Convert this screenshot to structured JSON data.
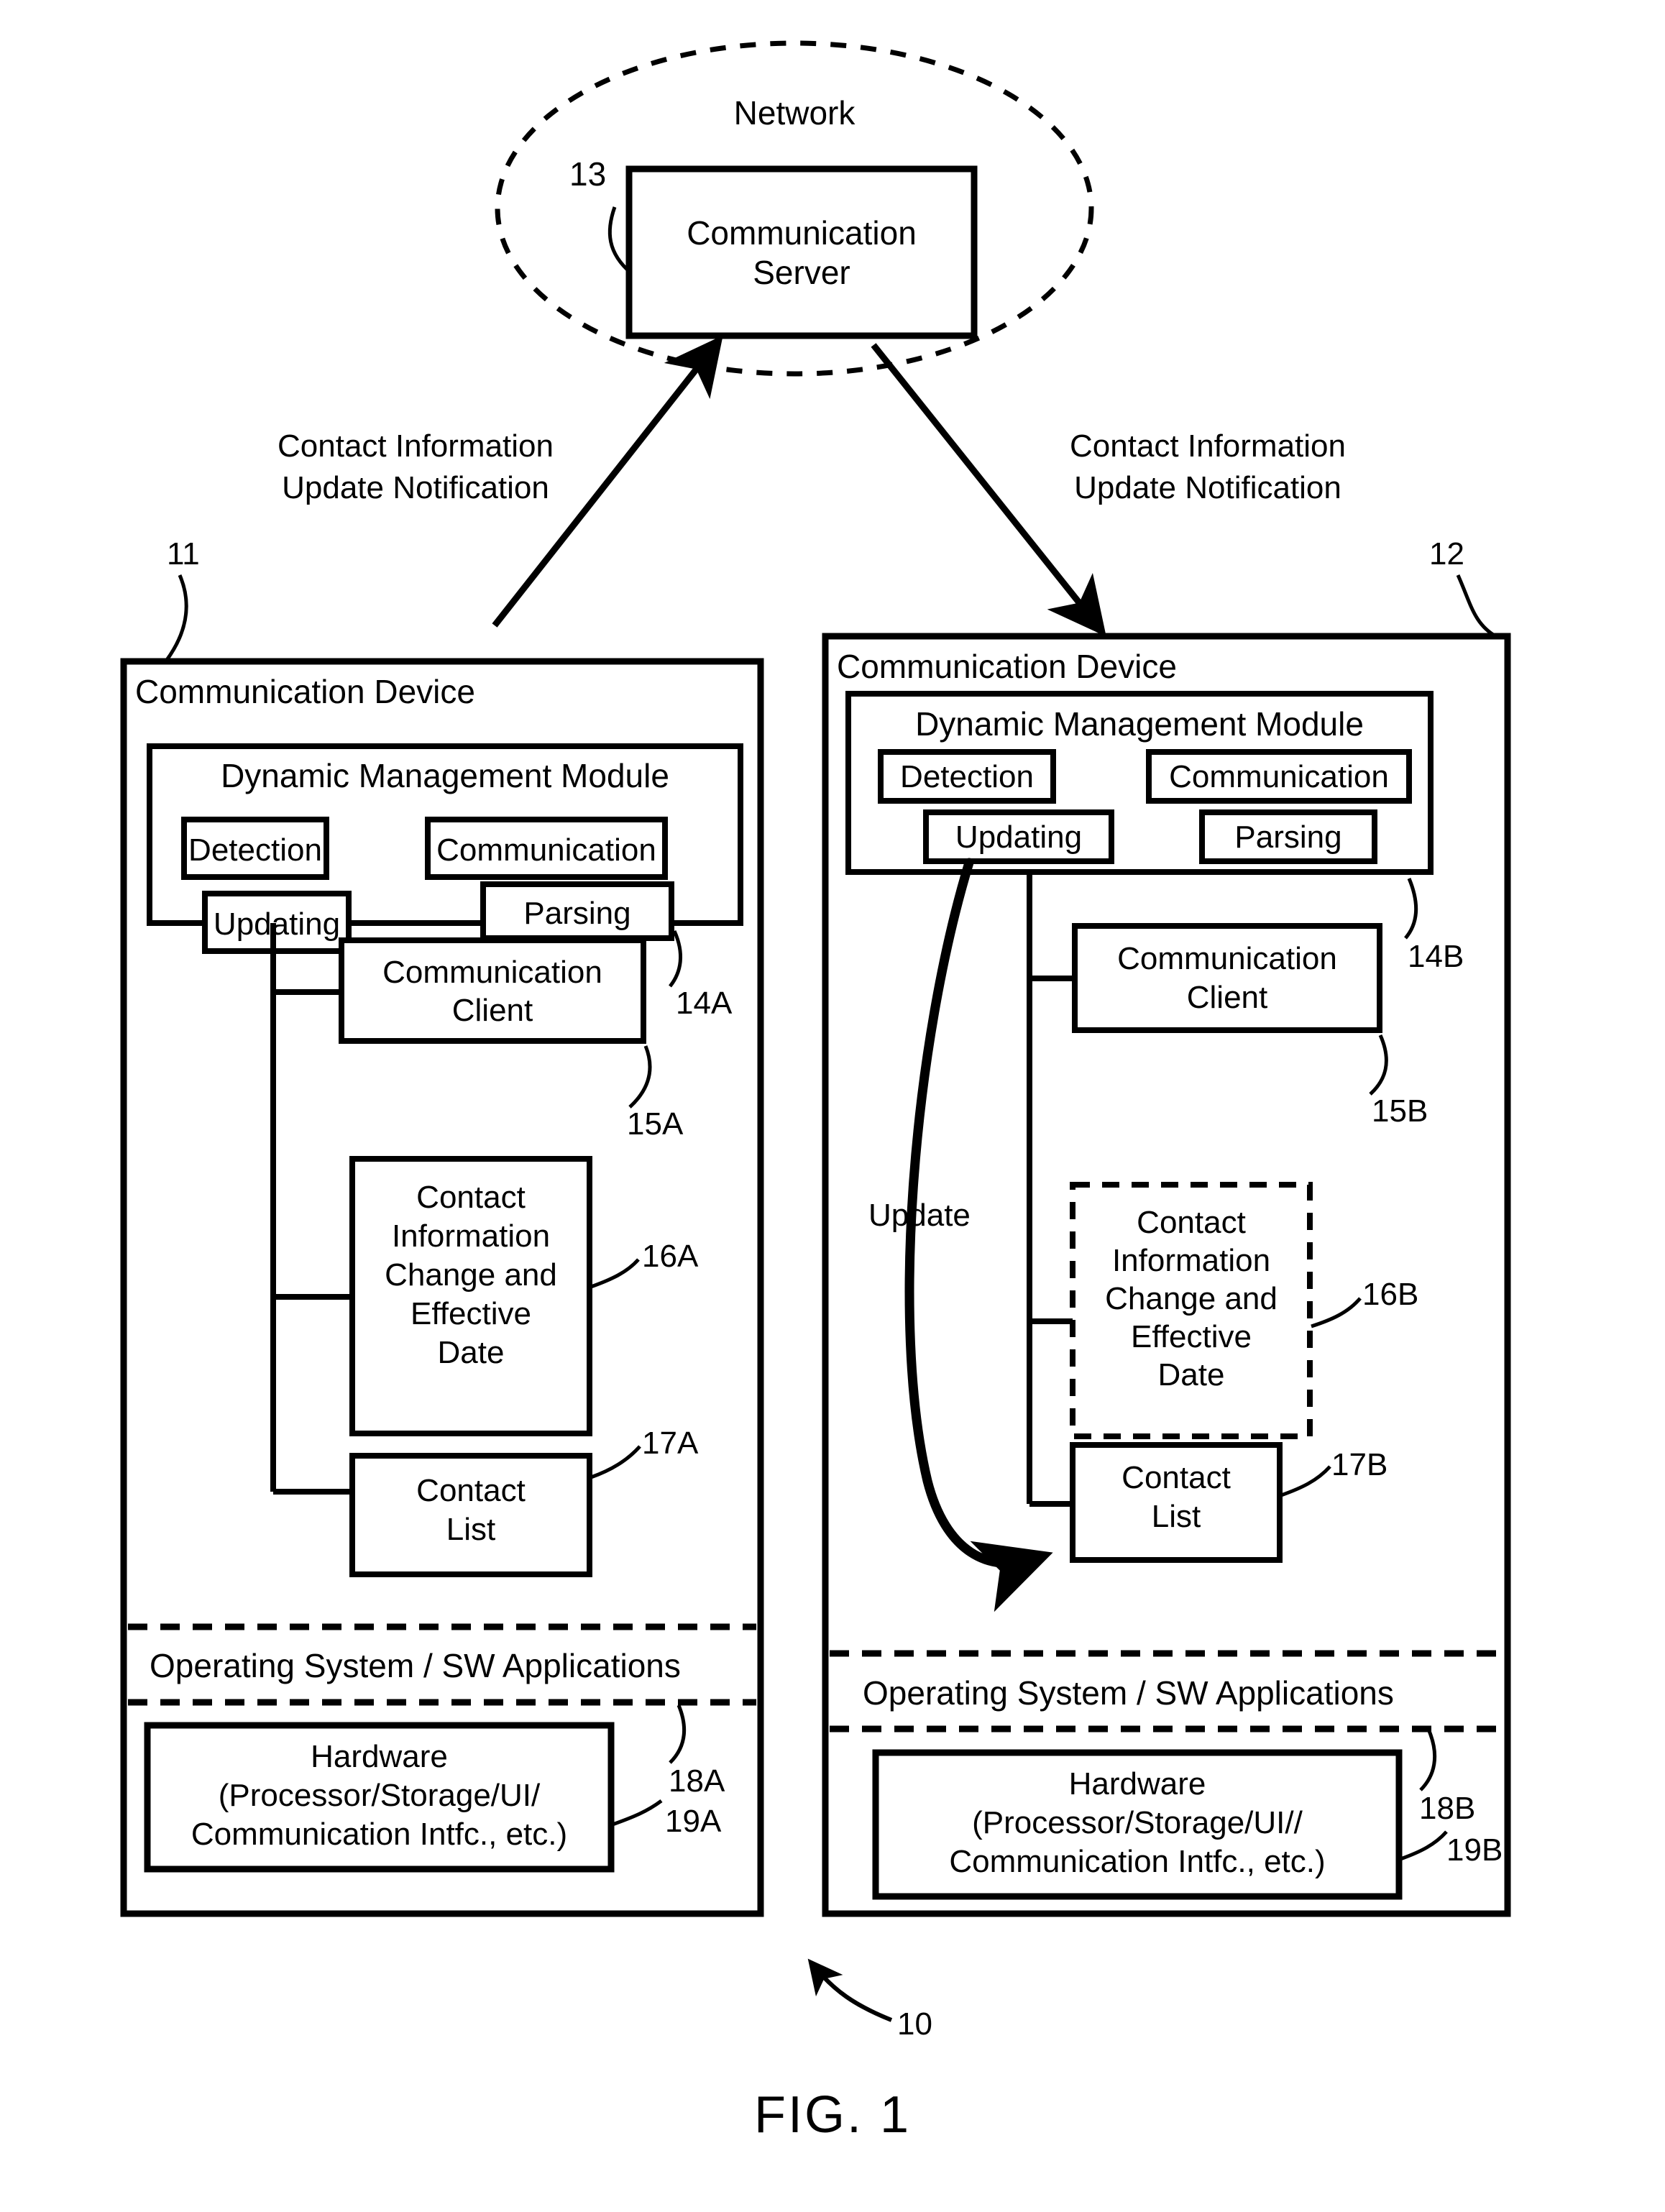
{
  "figure": {
    "caption": "FIG. 1",
    "system_ref": "10"
  },
  "network": {
    "label": "Network",
    "ref": "13",
    "server": {
      "line1": "Communication",
      "line2": "Server"
    }
  },
  "arrows": {
    "left_label_line1": "Contact Information",
    "left_label_line2": "Update Notification",
    "right_label_line1": "Contact Information",
    "right_label_line2": "Update Notification"
  },
  "device_left": {
    "title": "Communication Device",
    "ref": "11",
    "module": {
      "title": "Dynamic Management Module",
      "boxes": [
        {
          "label": "Detection"
        },
        {
          "label": "Communication"
        },
        {
          "label": "Updating"
        },
        {
          "label": "Parsing"
        }
      ]
    },
    "client": {
      "line1": "Communication",
      "line2": "Client",
      "ref_module": "14A",
      "ref_client": "15A"
    },
    "contact_info": {
      "line1": "Contact",
      "line2": "Information",
      "line3": "Change and",
      "line4": "Effective",
      "line5": "Date",
      "ref": "16A"
    },
    "contact_list": {
      "line1": "Contact",
      "line2": "List",
      "ref": "17A"
    },
    "os_layer": {
      "label": "Operating System / SW Applications",
      "ref": "18A"
    },
    "hardware": {
      "line1": "Hardware",
      "line2": "(Processor/Storage/UI/",
      "line3": "Communication Intfc., etc.)",
      "ref": "19A"
    }
  },
  "device_right": {
    "title": "Communication Device",
    "ref": "12",
    "module": {
      "title": "Dynamic Management Module",
      "boxes": [
        {
          "label": "Detection"
        },
        {
          "label": "Communication"
        },
        {
          "label": "Updating"
        },
        {
          "label": "Parsing"
        }
      ]
    },
    "client": {
      "line1": "Communication",
      "line2": "Client",
      "ref_module": "14B",
      "ref_client": "15B"
    },
    "contact_info": {
      "line1": "Contact",
      "line2": "Information",
      "line3": "Change and",
      "line4": "Effective",
      "line5": "Date",
      "ref": "16B"
    },
    "contact_list": {
      "line1": "Contact",
      "line2": "List",
      "ref": "17B"
    },
    "update_arrow": {
      "label": "Update"
    },
    "os_layer": {
      "label": "Operating System / SW Applications",
      "ref": "18B"
    },
    "hardware": {
      "line1": "Hardware",
      "line2": "(Processor/Storage/UI//",
      "line3": "Communication Intfc., etc.)",
      "ref": "19B"
    }
  },
  "colors": {
    "stroke": "#000000",
    "background": "#ffffff"
  }
}
